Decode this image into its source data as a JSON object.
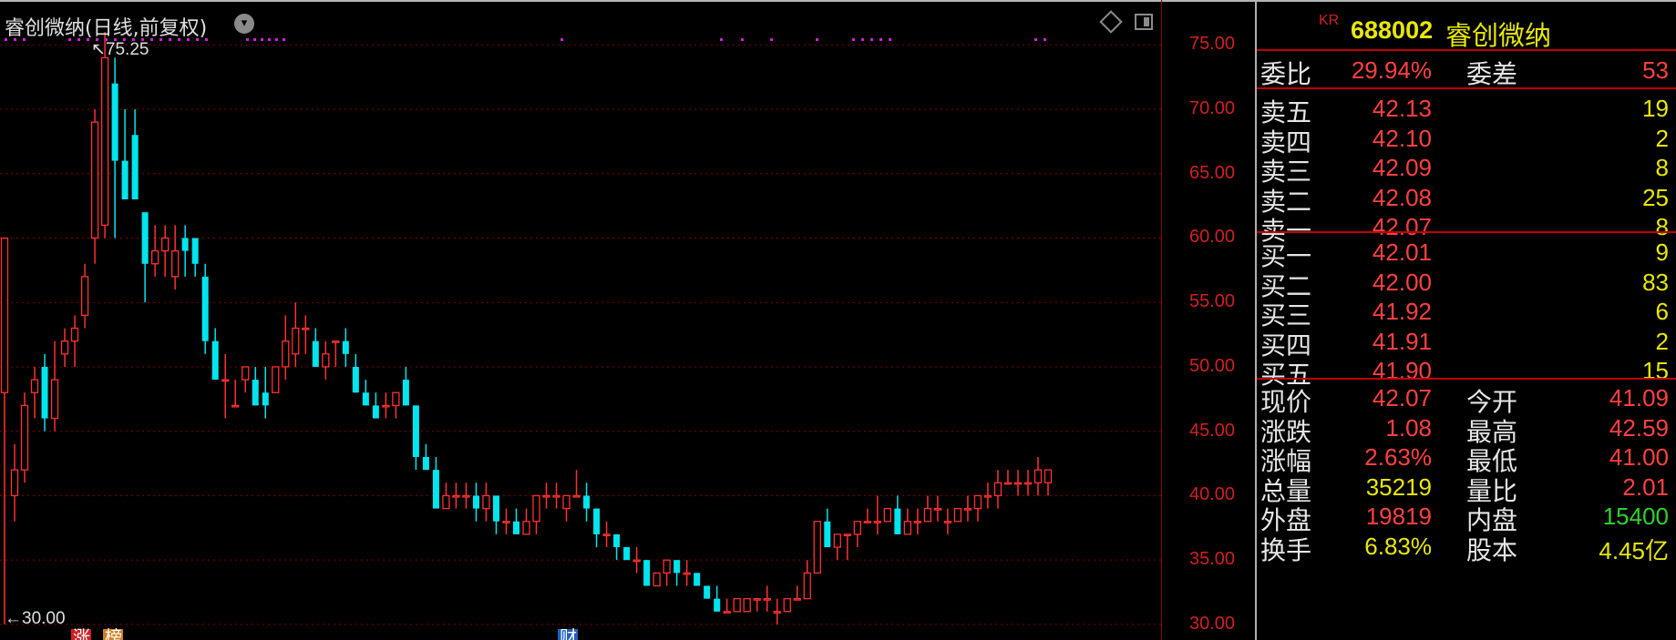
{
  "window": {
    "title": "睿创微纳(日线,前复权)",
    "dropdown_icon": "chevron-down-icon",
    "toolbar_icons": [
      "diamond-icon",
      "panel-toggle-icon"
    ]
  },
  "colors": {
    "up": "#ff3030",
    "down": "#00e5ee",
    "axis_text": "#d02020",
    "grid": "#8b0000",
    "label": "#e6e6e6",
    "yellow": "#e8e800",
    "green": "#30d030"
  },
  "markers": {
    "high_label": "75.25",
    "low_label": "30.00",
    "badges": [
      "涨",
      "榜",
      "财"
    ]
  },
  "axis": {
    "ticks": [
      "75.00",
      "70.00",
      "65.00",
      "60.00",
      "55.00",
      "50.00",
      "45.00",
      "40.00",
      "35.00",
      "30.00"
    ]
  },
  "chart_data": {
    "type": "candlestick",
    "title": "睿创微纳(日线,前复权)",
    "ylim": [
      29.5,
      76.5
    ],
    "y_ticks": [
      75,
      70,
      65,
      60,
      55,
      50,
      45,
      40,
      35,
      30
    ],
    "grid": true,
    "candles": [
      [
        48,
        60,
        30,
        60
      ],
      [
        40,
        44,
        38,
        42
      ],
      [
        42,
        48,
        41,
        47
      ],
      [
        48,
        50,
        46,
        49
      ],
      [
        50,
        51,
        45,
        46
      ],
      [
        46,
        52,
        45,
        49
      ],
      [
        51,
        53,
        50,
        52
      ],
      [
        52,
        54,
        50,
        53
      ],
      [
        54,
        58,
        53,
        57
      ],
      [
        60,
        70,
        58,
        69
      ],
      [
        61,
        76,
        60,
        74
      ],
      [
        72,
        74,
        60,
        66
      ],
      [
        66,
        70,
        63,
        63
      ],
      [
        68,
        70,
        65,
        63
      ],
      [
        62,
        61,
        55,
        58
      ],
      [
        58,
        61,
        57,
        59
      ],
      [
        59,
        61,
        57,
        60
      ],
      [
        57,
        61,
        56,
        59
      ],
      [
        60,
        61,
        57,
        59
      ],
      [
        60,
        60,
        57,
        58
      ],
      [
        57,
        58,
        51,
        52
      ],
      [
        52,
        53,
        50,
        49
      ],
      [
        49,
        51,
        46,
        49
      ],
      [
        47,
        49,
        47,
        47
      ],
      [
        49,
        50,
        48,
        50
      ],
      [
        49,
        50,
        47,
        47
      ],
      [
        48,
        50,
        46,
        47
      ],
      [
        48,
        50,
        48,
        50
      ],
      [
        50,
        54,
        49,
        52
      ],
      [
        51,
        55,
        50,
        53
      ],
      [
        53,
        54,
        51,
        53
      ],
      [
        52,
        53,
        50,
        50
      ],
      [
        50,
        52,
        49,
        51
      ],
      [
        52,
        52,
        50,
        52
      ],
      [
        52,
        53,
        50,
        51
      ],
      [
        50,
        51,
        48,
        48
      ],
      [
        48,
        49,
        47,
        47
      ],
      [
        47,
        48,
        46,
        46
      ],
      [
        47,
        48,
        46,
        47
      ],
      [
        47,
        48,
        46,
        48
      ],
      [
        49,
        50,
        47,
        47
      ],
      [
        47,
        47,
        42,
        43
      ],
      [
        43,
        44,
        42,
        42
      ],
      [
        42,
        43,
        39,
        39
      ],
      [
        39,
        41,
        39,
        40
      ],
      [
        40,
        41,
        39,
        40
      ],
      [
        40,
        41,
        39,
        40
      ],
      [
        40,
        41,
        38,
        39
      ],
      [
        39,
        41,
        38,
        40
      ],
      [
        40,
        40,
        37,
        38
      ],
      [
        38,
        39,
        37,
        38
      ],
      [
        38,
        39,
        37,
        37
      ],
      [
        37,
        39,
        37,
        38
      ],
      [
        38,
        40,
        37,
        40
      ],
      [
        40,
        41,
        39,
        40
      ],
      [
        40,
        41,
        39,
        40
      ],
      [
        39,
        40,
        38,
        40
      ],
      [
        40,
        42,
        40,
        40
      ],
      [
        40,
        41,
        38,
        39
      ],
      [
        39,
        39,
        36,
        37
      ],
      [
        37,
        38,
        36,
        37
      ],
      [
        37,
        37,
        35,
        36
      ],
      [
        36,
        36,
        35,
        35
      ],
      [
        35,
        36,
        34,
        35
      ],
      [
        35,
        35,
        33,
        33
      ],
      [
        33,
        34,
        33,
        34
      ],
      [
        34,
        35,
        33,
        35
      ],
      [
        35,
        35,
        33,
        34
      ],
      [
        34,
        35,
        33,
        34
      ],
      [
        34,
        34,
        33,
        33
      ],
      [
        33,
        33,
        32,
        32
      ],
      [
        32,
        33,
        31,
        31
      ],
      [
        31,
        32,
        31,
        31
      ],
      [
        31,
        32,
        31,
        32
      ],
      [
        31,
        32,
        31,
        32
      ],
      [
        32,
        32,
        31,
        32
      ],
      [
        32,
        33,
        31,
        32
      ],
      [
        31,
        32,
        30,
        31
      ],
      [
        31,
        32,
        31,
        32
      ],
      [
        32,
        33,
        32,
        32
      ],
      [
        32,
        35,
        32,
        34
      ],
      [
        34,
        38,
        34,
        38
      ],
      [
        38,
        39,
        36,
        36
      ],
      [
        36,
        37,
        35,
        37
      ],
      [
        37,
        37,
        35,
        37
      ],
      [
        37,
        38,
        36,
        38
      ],
      [
        38,
        39,
        38,
        38
      ],
      [
        38,
        40,
        37,
        38
      ],
      [
        38,
        39,
        38,
        39
      ],
      [
        39,
        40,
        37,
        37
      ],
      [
        37,
        39,
        37,
        38
      ],
      [
        38,
        39,
        37,
        38
      ],
      [
        38,
        40,
        38,
        39
      ],
      [
        39,
        40,
        38,
        39
      ],
      [
        38,
        39,
        37,
        38
      ],
      [
        38,
        39,
        38,
        39
      ],
      [
        39,
        40,
        38,
        39
      ],
      [
        39,
        40,
        38,
        40
      ],
      [
        40,
        41,
        39,
        40
      ],
      [
        40,
        42,
        39,
        41
      ],
      [
        41,
        42,
        41,
        41
      ],
      [
        41,
        42,
        40,
        41
      ],
      [
        41,
        42,
        40,
        41
      ],
      [
        41,
        43,
        40,
        42
      ],
      [
        41,
        42,
        40,
        42
      ]
    ]
  },
  "quote": {
    "kr": "KR",
    "code": "688002",
    "name": "睿创微纳",
    "weibi": {
      "label": "委比",
      "value": "29.94%",
      "label2": "委差",
      "value2": "53"
    },
    "sells": [
      {
        "label": "卖五",
        "price": "42.13",
        "vol": "19"
      },
      {
        "label": "卖四",
        "price": "42.10",
        "vol": "2"
      },
      {
        "label": "卖三",
        "price": "42.09",
        "vol": "8"
      },
      {
        "label": "卖二",
        "price": "42.08",
        "vol": "25"
      },
      {
        "label": "卖一",
        "price": "42.07",
        "vol": "8"
      }
    ],
    "buys": [
      {
        "label": "买一",
        "price": "42.01",
        "vol": "9"
      },
      {
        "label": "买二",
        "price": "42.00",
        "vol": "83"
      },
      {
        "label": "买三",
        "price": "41.92",
        "vol": "6"
      },
      {
        "label": "买四",
        "price": "41.91",
        "vol": "2"
      },
      {
        "label": "买五",
        "price": "41.90",
        "vol": "15"
      }
    ],
    "stats": [
      {
        "l1": "现价",
        "v1": "42.07",
        "l2": "今开",
        "v2": "41.09",
        "v2_color": "red"
      },
      {
        "l1": "涨跌",
        "v1": "1.08",
        "l2": "最高",
        "v2": "42.59",
        "v2_color": "red"
      },
      {
        "l1": "涨幅",
        "v1": "2.63%",
        "l2": "最低",
        "v2": "41.00",
        "v2_color": "red"
      },
      {
        "l1": "总量",
        "v1": "35219",
        "l2": "量比",
        "v2": "2.01",
        "v2_color": "red",
        "v1_color": "yellow"
      },
      {
        "l1": "外盘",
        "v1": "19819",
        "l2": "内盘",
        "v2": "15400",
        "v2_color": "green",
        "v1_color": "red"
      },
      {
        "l1": "换手",
        "v1": "6.83%",
        "l2": "股本",
        "v2": "4.45亿",
        "v2_color": "yellow",
        "v1_color": "yellow"
      }
    ]
  }
}
